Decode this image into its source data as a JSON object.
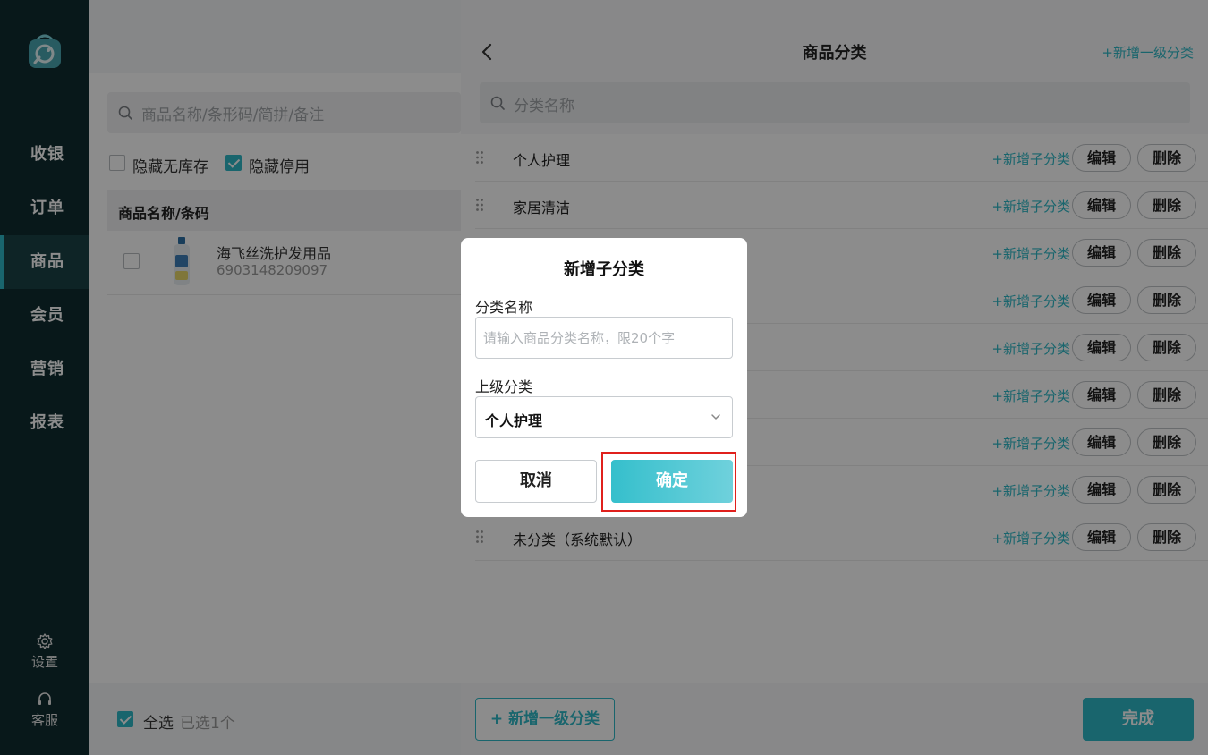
{
  "nav": {
    "items": [
      "收银",
      "订单",
      "商品",
      "会员",
      "营销",
      "报表"
    ],
    "active_index": 2,
    "settings_label": "设置",
    "support_label": "客服"
  },
  "product_list": {
    "search_placeholder": "商品名称/条形码/简拼/备注",
    "filters": [
      {
        "label": "隐藏无库存",
        "checked": false
      },
      {
        "label": "隐藏停用",
        "checked": true
      }
    ],
    "column_header": "商品名称/条码",
    "rows": [
      {
        "name": "海飞丝洗护发用品",
        "barcode": "6903148209097",
        "checked": false
      }
    ],
    "select_all_label": "全选",
    "select_all_checked": true,
    "selected_count_text": "已选1个"
  },
  "category_panel": {
    "title": "商品分类",
    "top_add_label": "+新增一级分类",
    "search_placeholder": "分类名称",
    "categories": [
      "个人护理",
      "家居清洁",
      "",
      "",
      "",
      "",
      "",
      "",
      "未分类（系统默认）"
    ],
    "add_sub_label": "+新增子分类",
    "edit_label": "编辑",
    "delete_label": "删除",
    "bottom_add_label": "+ 新增一级分类",
    "done_label": "完成"
  },
  "modal": {
    "title": "新增子分类",
    "name_label": "分类名称",
    "name_placeholder": "请输入商品分类名称，限20个字",
    "name_value": "",
    "parent_label": "上级分类",
    "parent_value": "个人护理",
    "cancel_label": "取消",
    "confirm_label": "确定"
  },
  "colors": {
    "accent": "#2fb9c6",
    "nav_bg": "#0f2d31",
    "highlight_frame": "#e0201c"
  }
}
